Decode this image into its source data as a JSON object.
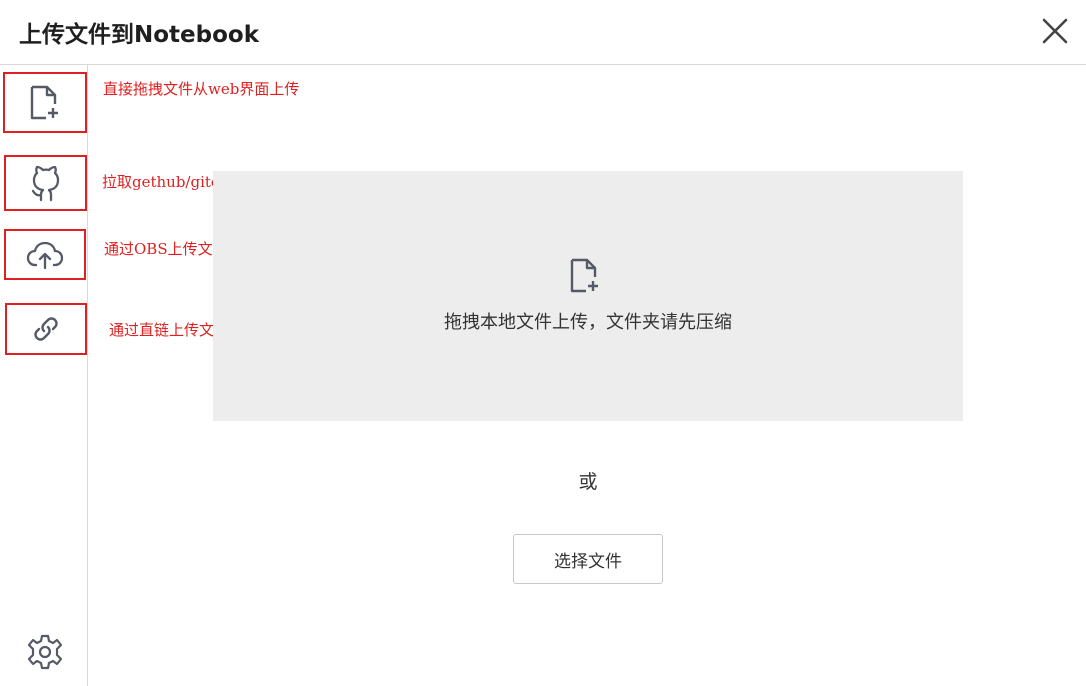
{
  "dialog": {
    "title": "上传文件到Notebook",
    "close_icon": "close-icon"
  },
  "sidebar": {
    "items": [
      {
        "icon": "file-add-icon",
        "annotation": "直接拖拽文件从web界面上传"
      },
      {
        "icon": "github-icon",
        "annotation": "拉取gethub/gitee项目"
      },
      {
        "icon": "cloud-upload-icon",
        "annotation": "通过OBS上传文件"
      },
      {
        "icon": "link-icon",
        "annotation": "通过直链上传文件"
      }
    ],
    "settings_icon": "gear-icon",
    "annotation_color": "#e02020"
  },
  "main": {
    "dropzone_text": "拖拽本地文件上传，文件夹请先压缩",
    "or_text": "或",
    "choose_button_label": "选择文件"
  }
}
